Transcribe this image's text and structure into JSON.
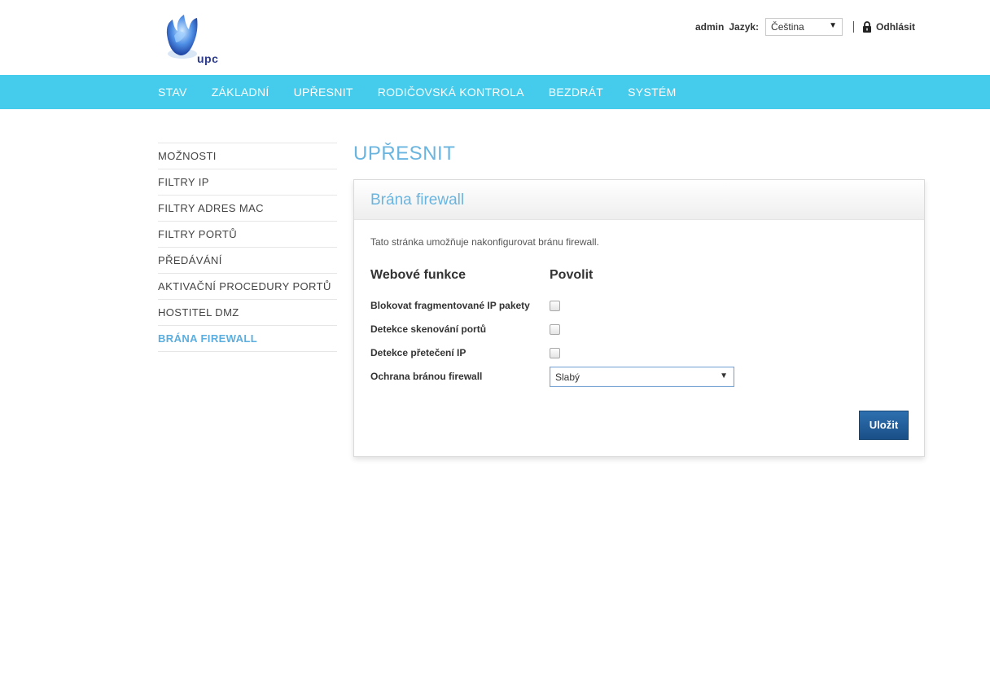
{
  "header": {
    "logo_text": "upc",
    "user": "admin",
    "language_label": "Jazyk:",
    "language_value": "Čeština",
    "logout_label": "Odhlásit"
  },
  "nav": {
    "items": [
      "STAV",
      "ZÁKLADNÍ",
      "UPŘESNIT",
      "RODIČOVSKÁ KONTROLA",
      "BEZDRÁT",
      "SYSTÉM"
    ]
  },
  "sidebar": {
    "items": [
      {
        "label": "MOŽNOSTI",
        "active": false
      },
      {
        "label": "FILTRY IP",
        "active": false
      },
      {
        "label": "FILTRY ADRES MAC",
        "active": false
      },
      {
        "label": "FILTRY PORTŮ",
        "active": false
      },
      {
        "label": "PŘEDÁVÁNÍ",
        "active": false
      },
      {
        "label": "AKTIVAČNÍ PROCEDURY PORTŮ",
        "active": false
      },
      {
        "label": "HOSTITEL DMZ",
        "active": false
      },
      {
        "label": "BRÁNA FIREWALL",
        "active": true
      }
    ]
  },
  "main": {
    "page_title": "UPŘESNIT",
    "panel_title": "Brána firewall",
    "description": "Tato stránka umožňuje nakonfigurovat bránu firewall.",
    "col_feature": "Webové funkce",
    "col_enable": "Povolit",
    "rows": [
      {
        "label": "Blokovat fragmentované IP pakety",
        "checked": false
      },
      {
        "label": "Detekce skenování portů",
        "checked": false
      },
      {
        "label": "Detekce přetečení IP",
        "checked": false
      }
    ],
    "protection_label": "Ochrana bránou firewall",
    "protection_value": "Slabý",
    "save_label": "Uložit"
  },
  "colors": {
    "nav_bg": "#45cbeb",
    "accent": "#6ab5e0",
    "button": "#1f5a96"
  }
}
